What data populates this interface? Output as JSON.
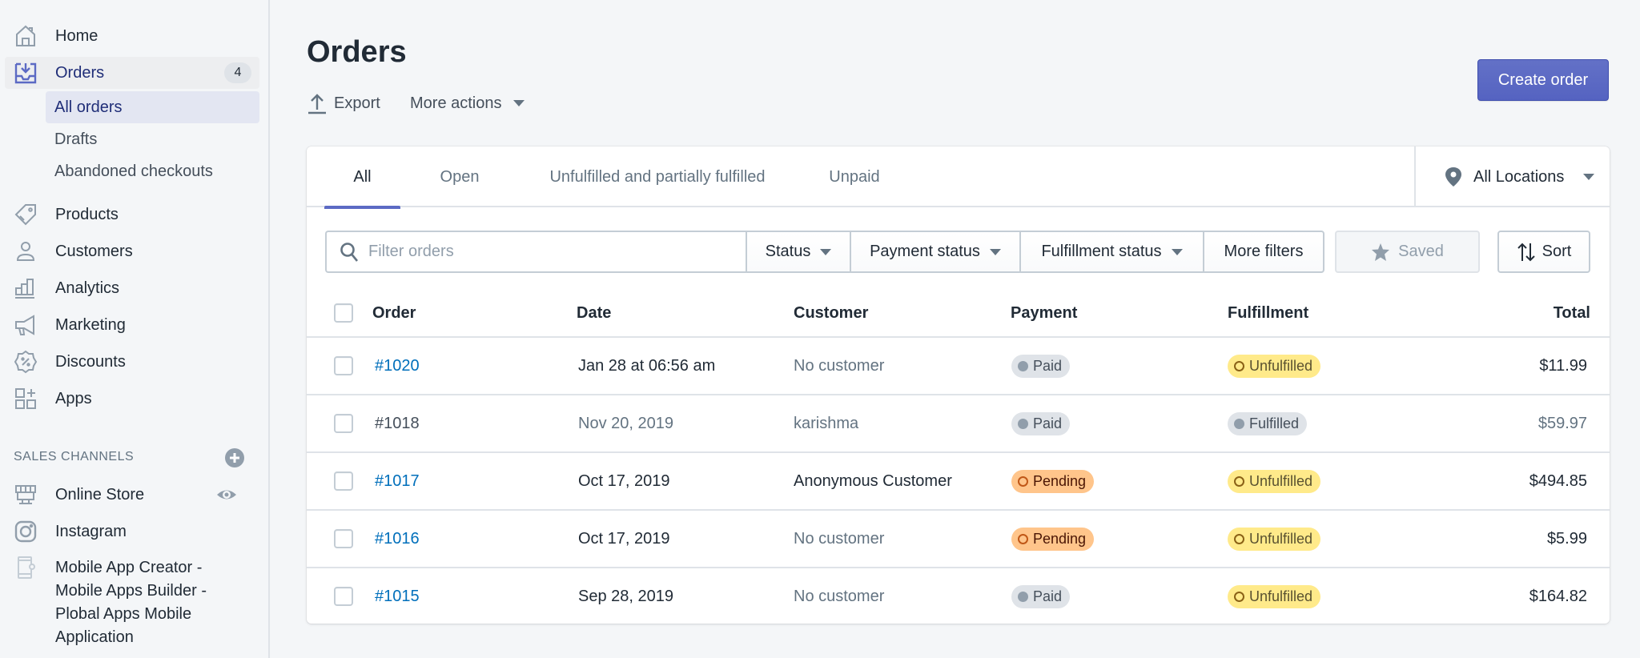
{
  "sidebar": {
    "nav": [
      {
        "label": "Home",
        "icon": "home-icon"
      },
      {
        "label": "Orders",
        "icon": "orders-icon",
        "badge": "4",
        "active": true
      },
      {
        "label": "Products",
        "icon": "tag-icon"
      },
      {
        "label": "Customers",
        "icon": "person-icon"
      },
      {
        "label": "Analytics",
        "icon": "bar-chart-icon"
      },
      {
        "label": "Marketing",
        "icon": "megaphone-icon"
      },
      {
        "label": "Discounts",
        "icon": "discount-icon"
      },
      {
        "label": "Apps",
        "icon": "apps-icon"
      }
    ],
    "orders_sub": [
      {
        "label": "All orders",
        "selected": true
      },
      {
        "label": "Drafts"
      },
      {
        "label": "Abandoned checkouts"
      }
    ],
    "sales_channels_title": "SALES CHANNELS",
    "channels": [
      {
        "label": "Online Store",
        "icon": "store-icon"
      },
      {
        "label": "Instagram",
        "icon": "instagram-icon"
      },
      {
        "label": "Mobile App Creator - Mobile Apps Builder - Plobal Apps Mobile Application",
        "icon": "mobile-app-icon"
      }
    ]
  },
  "page": {
    "title": "Orders",
    "export_label": "Export",
    "more_actions_label": "More actions",
    "create_order_label": "Create order"
  },
  "tabs": [
    {
      "label": "All",
      "active": true
    },
    {
      "label": "Open"
    },
    {
      "label": "Unfulfilled and partially fulfilled"
    },
    {
      "label": "Unpaid"
    }
  ],
  "location_filter": {
    "label": "All Locations"
  },
  "filters": {
    "search_placeholder": "Filter orders",
    "status": "Status",
    "payment_status": "Payment status",
    "fulfillment_status": "Fulfillment status",
    "more_filters": "More filters",
    "saved": "Saved",
    "sort": "Sort"
  },
  "table": {
    "headers": {
      "order": "Order",
      "date": "Date",
      "customer": "Customer",
      "payment": "Payment",
      "fulfillment": "Fulfillment",
      "total": "Total"
    },
    "rows": [
      {
        "order": "#1020",
        "date": "Jan 28 at 06:56 am",
        "customer": "No customer",
        "customer_muted": true,
        "payment": "Paid",
        "payment_tone": "gray",
        "fulfillment": "Unfulfilled",
        "fulfillment_tone": "yellow",
        "total": "$11.99",
        "archived": false
      },
      {
        "order": "#1018",
        "date": "Nov 20, 2019",
        "customer": "karishma",
        "customer_muted": true,
        "payment": "Paid",
        "payment_tone": "gray",
        "fulfillment": "Fulfilled",
        "fulfillment_tone": "gray",
        "total": "$59.97",
        "archived": true
      },
      {
        "order": "#1017",
        "date": "Oct 17, 2019",
        "customer": "Anonymous Customer",
        "customer_muted": false,
        "payment": "Pending",
        "payment_tone": "orange",
        "fulfillment": "Unfulfilled",
        "fulfillment_tone": "yellow",
        "total": "$494.85",
        "archived": false
      },
      {
        "order": "#1016",
        "date": "Oct 17, 2019",
        "customer": "No customer",
        "customer_muted": true,
        "payment": "Pending",
        "payment_tone": "orange",
        "fulfillment": "Unfulfilled",
        "fulfillment_tone": "yellow",
        "total": "$5.99",
        "archived": false
      },
      {
        "order": "#1015",
        "date": "Sep 28, 2019",
        "customer": "No customer",
        "customer_muted": true,
        "payment": "Paid",
        "payment_tone": "gray",
        "fulfillment": "Unfulfilled",
        "fulfillment_tone": "yellow",
        "total": "$164.82",
        "archived": false
      }
    ]
  },
  "colors": {
    "accent": "#5c6ac4",
    "link": "#006fbb",
    "badge_paid": "#dfe3e8",
    "badge_pending": "#ffc58b",
    "badge_unfulfilled": "#ffea8a"
  }
}
